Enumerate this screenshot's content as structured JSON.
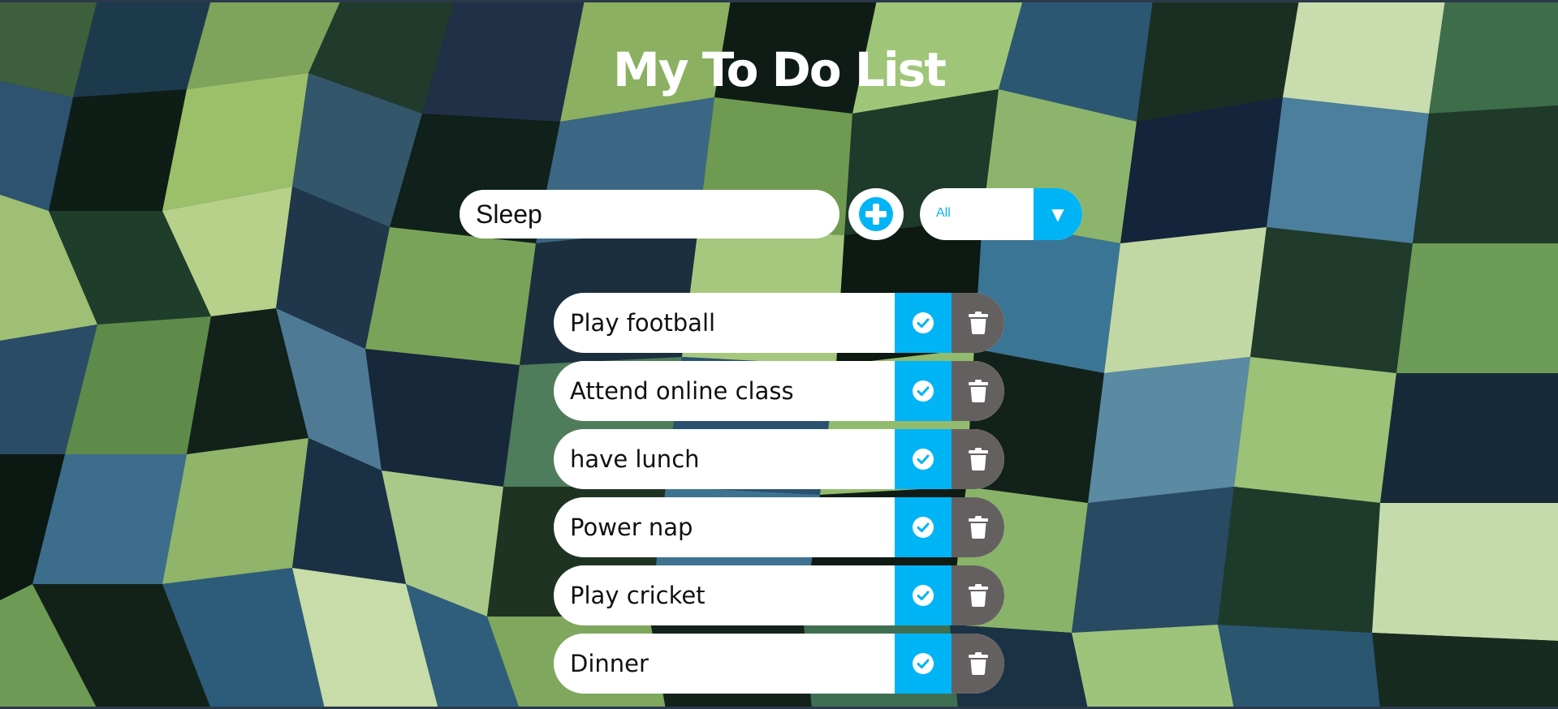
{
  "app": {
    "title": "My To Do List"
  },
  "form": {
    "input_value": "Sleep",
    "add_icon": "plus-circle-icon",
    "filter": {
      "selected": "All",
      "arrow_icon": "caret-down-icon"
    }
  },
  "todos": [
    {
      "text": "Play football"
    },
    {
      "text": "Attend online class"
    },
    {
      "text": "have lunch"
    },
    {
      "text": "Power nap"
    },
    {
      "text": "Play cricket"
    },
    {
      "text": "Dinner"
    }
  ],
  "item_icons": {
    "complete": "check-circle-icon",
    "delete": "trash-icon"
  },
  "colors": {
    "accent": "#00b4f5",
    "delete": "#656060",
    "title_text": "#ffffff"
  }
}
